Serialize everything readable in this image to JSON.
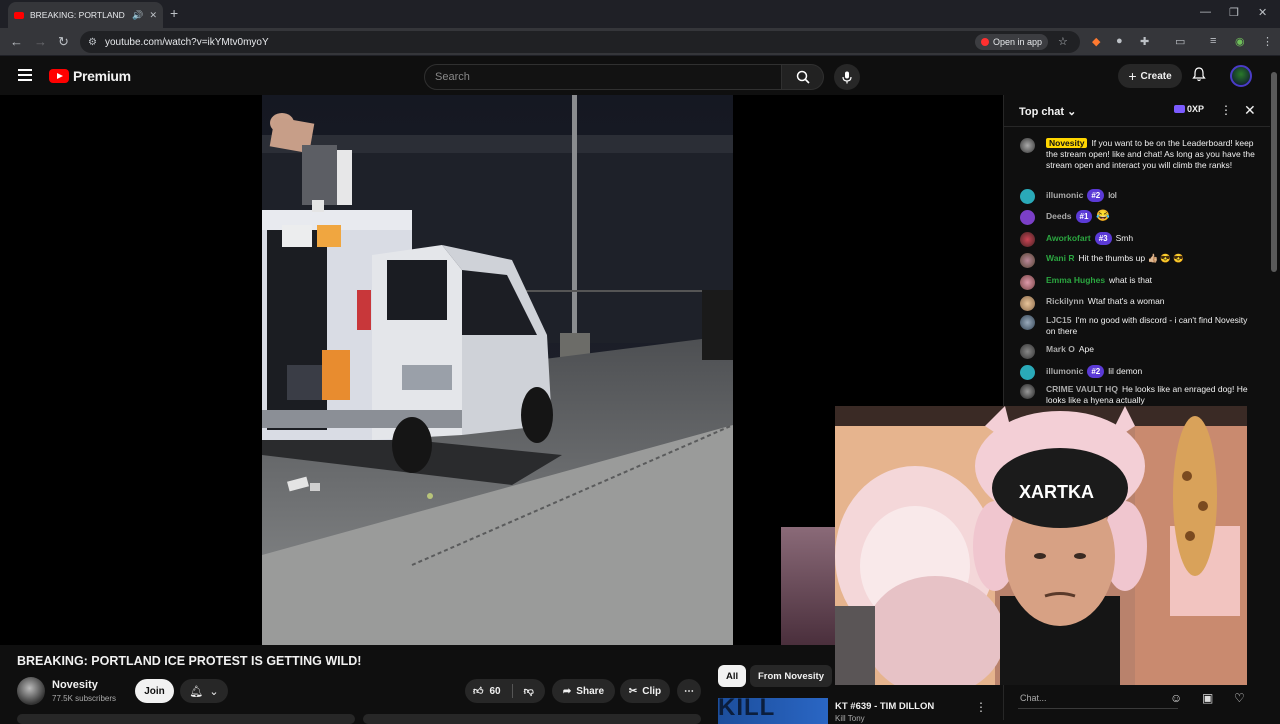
{
  "browser": {
    "tab_title": "BREAKING: PORTLAND ICE",
    "url": "youtube.com/watch?v=ikYMtv0myoY",
    "open_in_app": "Open in app"
  },
  "header": {
    "brand": "Premium",
    "search_placeholder": "Search",
    "create_label": "Create"
  },
  "video": {
    "title": "BREAKING: PORTLAND ICE PROTEST IS GETTING WILD!",
    "channel": "Novesity",
    "subscribers": "77.5K subscribers",
    "join_label": "Join",
    "likes": "60",
    "share_label": "Share",
    "clip_label": "Clip"
  },
  "chat": {
    "title": "Top chat",
    "xp": "0XP",
    "input_placeholder": "Chat...",
    "messages": [
      {
        "author": "Novesity",
        "text": "If you want to be on the Leaderboard! keep the stream open! like and chat! As long as you have the stream open and interact you will climb the ranks!"
      },
      {
        "author": "illumonic",
        "rank": "#2",
        "text": "lol"
      },
      {
        "author": "Deeds",
        "rank": "#1",
        "text": "😂"
      },
      {
        "author": "Aworkofart",
        "rank": "#3",
        "text": "Smh"
      },
      {
        "author": "Wani R",
        "text": "Hit the thumbs up 👍🏼 😎 😎"
      },
      {
        "author": "Emma Hughes",
        "text": "what is that"
      },
      {
        "author": "Rickilynn",
        "text": "Wtaf that's a woman"
      },
      {
        "author": "LJC15",
        "text": "I'm no good with discord - i can't find Novesity on there"
      },
      {
        "author": "Mark O",
        "text": "Ape"
      },
      {
        "author": "illumonic",
        "rank": "#2",
        "text": "lil demon"
      },
      {
        "author": "CRIME VAULT HQ",
        "text": "He looks like an enraged dog! He looks like a hyena actually"
      }
    ]
  },
  "chips": {
    "all": "All",
    "from_channel": "From Novesity"
  },
  "recommendation": {
    "thumb_text": "KILL TONY",
    "title": "KT #639 - TIM DILLON",
    "channel": "Kill Tony"
  },
  "cam": {
    "beanie_text": "XARTKA"
  }
}
